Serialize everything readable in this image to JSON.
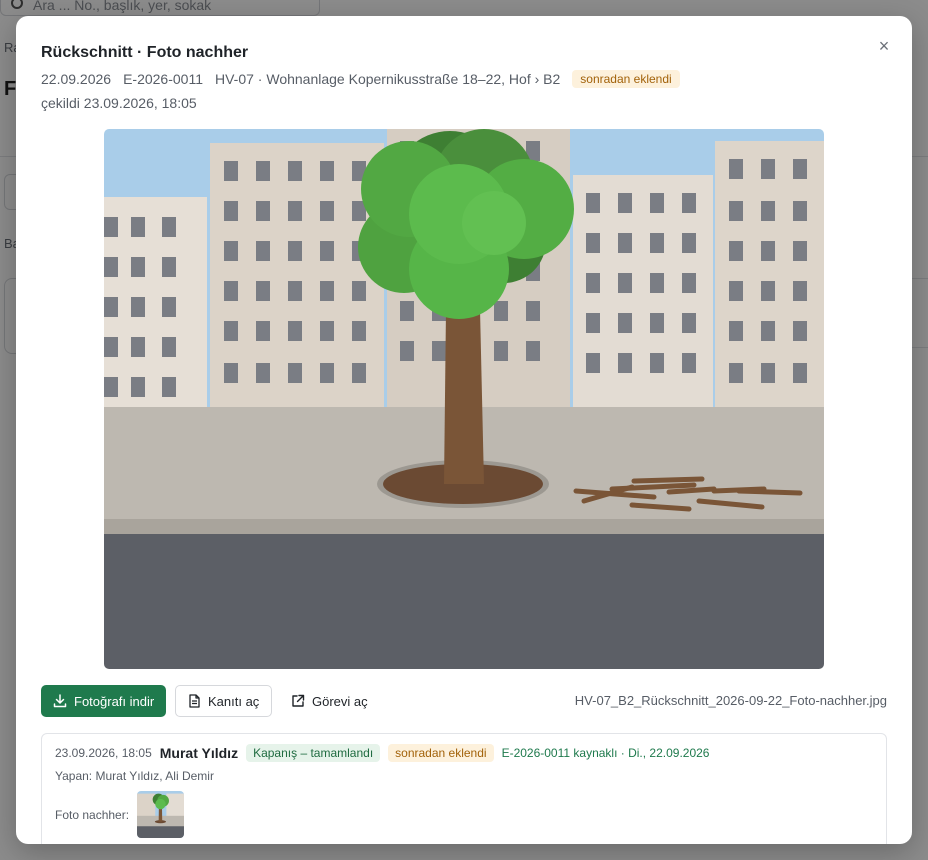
{
  "background": {
    "search_placeholder": "Ara ... No., başlık, yer, sokak",
    "frag_ra": "Ra",
    "frag_fo": "Fo",
    "frag_ba": "Ba"
  },
  "modal": {
    "title": "Rückschnitt · Foto nachher",
    "date": "22.09.2026",
    "id": "E-2026-0011",
    "location": "HV-07 · Wohnanlage Kopernikusstraße 18–22, Hof › B2",
    "late_badge": "sonradan eklendi",
    "taken": "çekildi 23.09.2026, 18:05",
    "close_label": "×"
  },
  "actions": {
    "download": "Fotoğrafı indir",
    "open_evidence": "Kanıtı aç",
    "open_task": "Görevi aç",
    "filename": "HV-07_B2_Rückschnitt_2026-09-22_Foto-nachher.jpg"
  },
  "entry": {
    "time": "23.09.2026, 18:05",
    "user": "Murat Yıldız",
    "status_tag": "Kapanış – tamamlandı",
    "late_tag": "sonradan eklendi",
    "source": "E-2026-0011 kaynaklı · Di., 22.09.2026",
    "done_by": "Yapan: Murat Yıldız, Ali Demir",
    "photo_label": "Foto nachher:"
  },
  "colors": {
    "primary": "#1f7a4d",
    "badge_amber_bg": "#fdf1dc",
    "badge_amber_text": "#a2620a",
    "tag_green_bg": "#e6f3ea"
  },
  "icons": {
    "close": "close-icon",
    "download": "download-icon",
    "evidence": "document-icon",
    "task": "external-link-icon"
  }
}
